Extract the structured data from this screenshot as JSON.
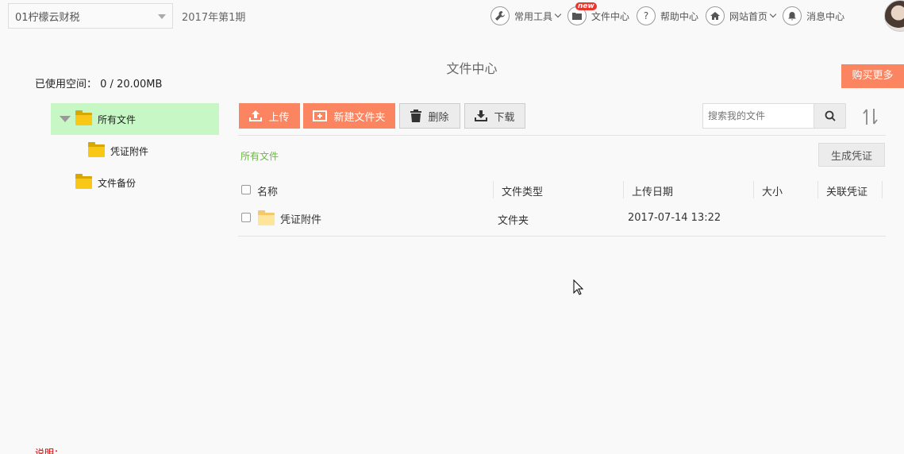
{
  "header": {
    "company": "01柠檬云财税",
    "period": "2017年第1期",
    "nav": [
      {
        "label": "常用工具",
        "icon": "wrench-icon"
      },
      {
        "label": "文件中心",
        "icon": "folder-icon",
        "badge": "new"
      },
      {
        "label": "帮助中心",
        "icon": "question-icon"
      },
      {
        "label": "网站首页",
        "icon": "home-icon"
      },
      {
        "label": "消息中心",
        "icon": "bell-icon"
      }
    ]
  },
  "page": {
    "title": "文件中心",
    "buy_more": "购买更多",
    "used_space_label": "已使用空间：",
    "used_space_value": "0 / 20.00MB",
    "note": "说明："
  },
  "tree": {
    "items": [
      {
        "label": "所有文件"
      },
      {
        "label": "凭证附件"
      },
      {
        "label": "文件备份"
      }
    ]
  },
  "toolbar": {
    "upload": "上传",
    "new_folder": "新建文件夹",
    "delete": "删除",
    "download": "下载",
    "search_placeholder": "搜索我的文件"
  },
  "breadcrumb": "所有文件",
  "generate_voucher": "生成凭证",
  "table": {
    "columns": [
      "名称",
      "文件类型",
      "上传日期",
      "大小",
      "关联凭证"
    ],
    "rows": [
      {
        "name": "凭证附件",
        "type": "文件夹",
        "date": "2017-07-14 13:22",
        "size": "",
        "voucher": ""
      }
    ]
  },
  "colors": {
    "accent": "#fb8561",
    "active_tree_bg": "#c6f7c4",
    "breadcrumb": "#6cb842",
    "folder": "#f9c817"
  }
}
